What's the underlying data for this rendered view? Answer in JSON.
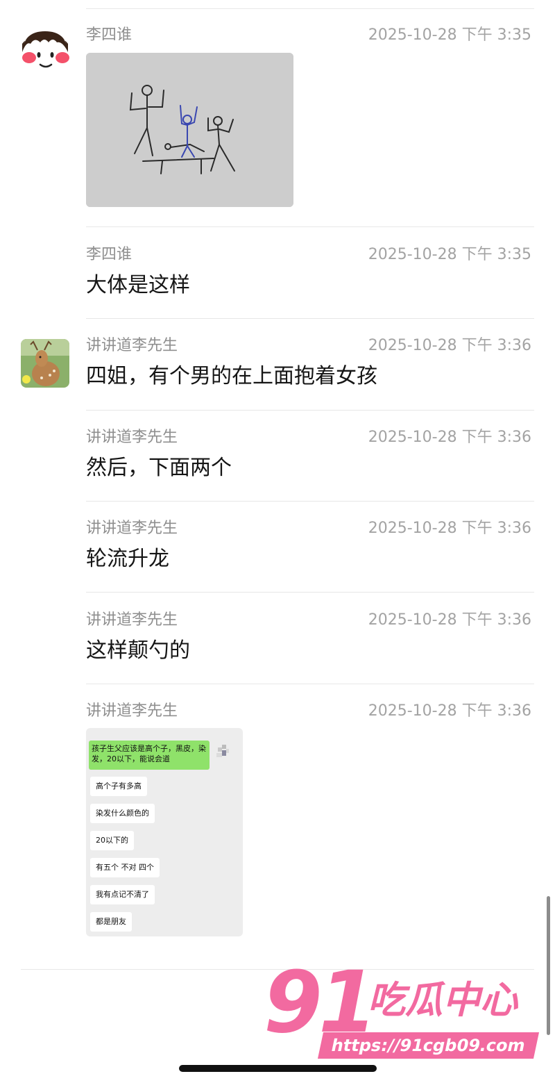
{
  "messages": [
    {
      "sender": "李四谁",
      "time": "2025-10-28 下午 3:35",
      "type": "image"
    },
    {
      "sender": "李四谁",
      "time": "2025-10-28 下午 3:35",
      "text": "大体是这样"
    },
    {
      "sender": "讲讲道李先生",
      "time": "2025-10-28 下午 3:36",
      "text": "四姐，有个男的在上面抱着女孩"
    },
    {
      "sender": "讲讲道李先生",
      "time": "2025-10-28 下午 3:36",
      "text": "然后，下面两个"
    },
    {
      "sender": "讲讲道李先生",
      "time": "2025-10-28 下午 3:36",
      "text": "轮流升龙"
    },
    {
      "sender": "讲讲道李先生",
      "time": "2025-10-28 下午 3:36",
      "text": "这样颠勺的"
    },
    {
      "sender": "讲讲道李先生",
      "time": "2025-10-28 下午 3:36",
      "type": "image"
    }
  ],
  "screenshot_chat": {
    "green": "孩子生父应该是高个子，黑皮，染发，20以下，能说会道",
    "bubbles": [
      "高个子有多高",
      "染发什么颜色的",
      "20以下的",
      "有五个 不对 四个",
      "我有点记不清了",
      "都是朋友"
    ]
  },
  "watermark": {
    "number": "91",
    "title": "吃瓜中心",
    "url": "https://91cgb09.com"
  },
  "colors": {
    "watermark": "#f26aa0",
    "chat_green": "#8fe26a",
    "name_gray": "#8f8f8f"
  }
}
